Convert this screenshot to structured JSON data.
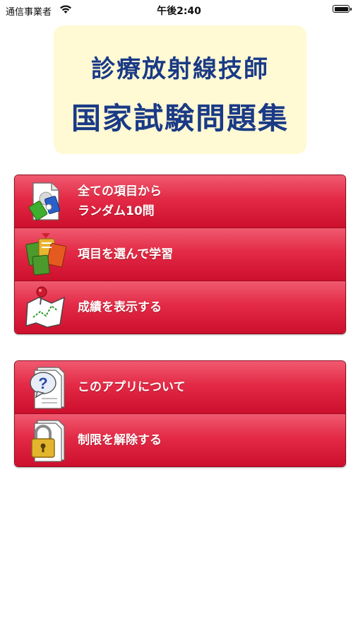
{
  "status_bar": {
    "carrier": "通信事業者",
    "time": "午後2:40"
  },
  "header": {
    "title_line1": "診療放射線技師",
    "title_line2": "国家試験問題集"
  },
  "menu_main": {
    "items": [
      {
        "label_line1": "全ての項目から",
        "label_line2": "ランダム10問",
        "icon": "random-cards-icon"
      },
      {
        "label": "項目を選んで学習",
        "icon": "notebooks-icon"
      },
      {
        "label": "成績を表示する",
        "icon": "map-pin-chart-icon"
      }
    ]
  },
  "menu_info": {
    "items": [
      {
        "label": "このアプリについて",
        "icon": "question-document-icon"
      },
      {
        "label": "制限を解除する",
        "icon": "lock-document-icon"
      }
    ]
  },
  "colors": {
    "menu_red": "#e32a46",
    "title_blue": "#1a3a86",
    "title_bg": "#fff9d4"
  }
}
